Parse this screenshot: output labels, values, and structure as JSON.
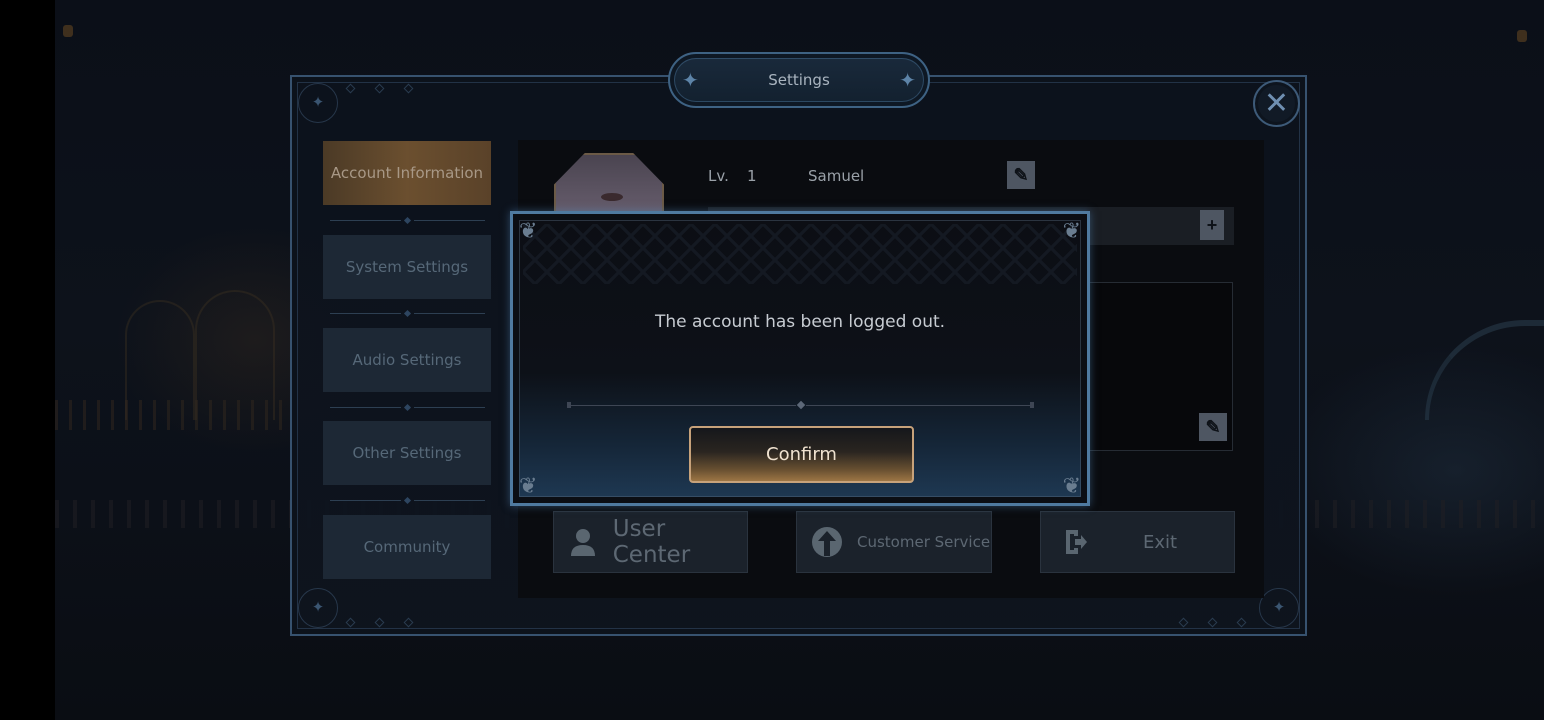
{
  "window": {
    "title": "Settings",
    "close_icon": "close-icon"
  },
  "sidebar": {
    "items": [
      {
        "label": "Account Information",
        "active": true
      },
      {
        "label": "System Settings",
        "active": false
      },
      {
        "label": "Audio Settings",
        "active": false
      },
      {
        "label": "Other Settings",
        "active": false
      },
      {
        "label": "Community",
        "active": false
      }
    ]
  },
  "account": {
    "level_label": "Lv.",
    "level_value": "1",
    "username": "Samuel",
    "edit_name_icon": "edit-icon",
    "copy_id_icon": "add-file-icon",
    "edit_signature_icon": "edit-icon"
  },
  "actions": {
    "user_center": {
      "label": "User Center",
      "icon": "user-icon"
    },
    "customer_service": {
      "label": "Customer Service",
      "icon": "upload-arrow-icon"
    },
    "exit": {
      "label": "Exit",
      "icon": "exit-door-icon"
    }
  },
  "dialog": {
    "message": "The account has been logged out.",
    "confirm_label": "Confirm"
  },
  "colors": {
    "frame_border": "#37526f",
    "active_tab": "#6b4f2f",
    "confirm_border": "#c7a27a",
    "modal_border": "#4f7aa0"
  }
}
